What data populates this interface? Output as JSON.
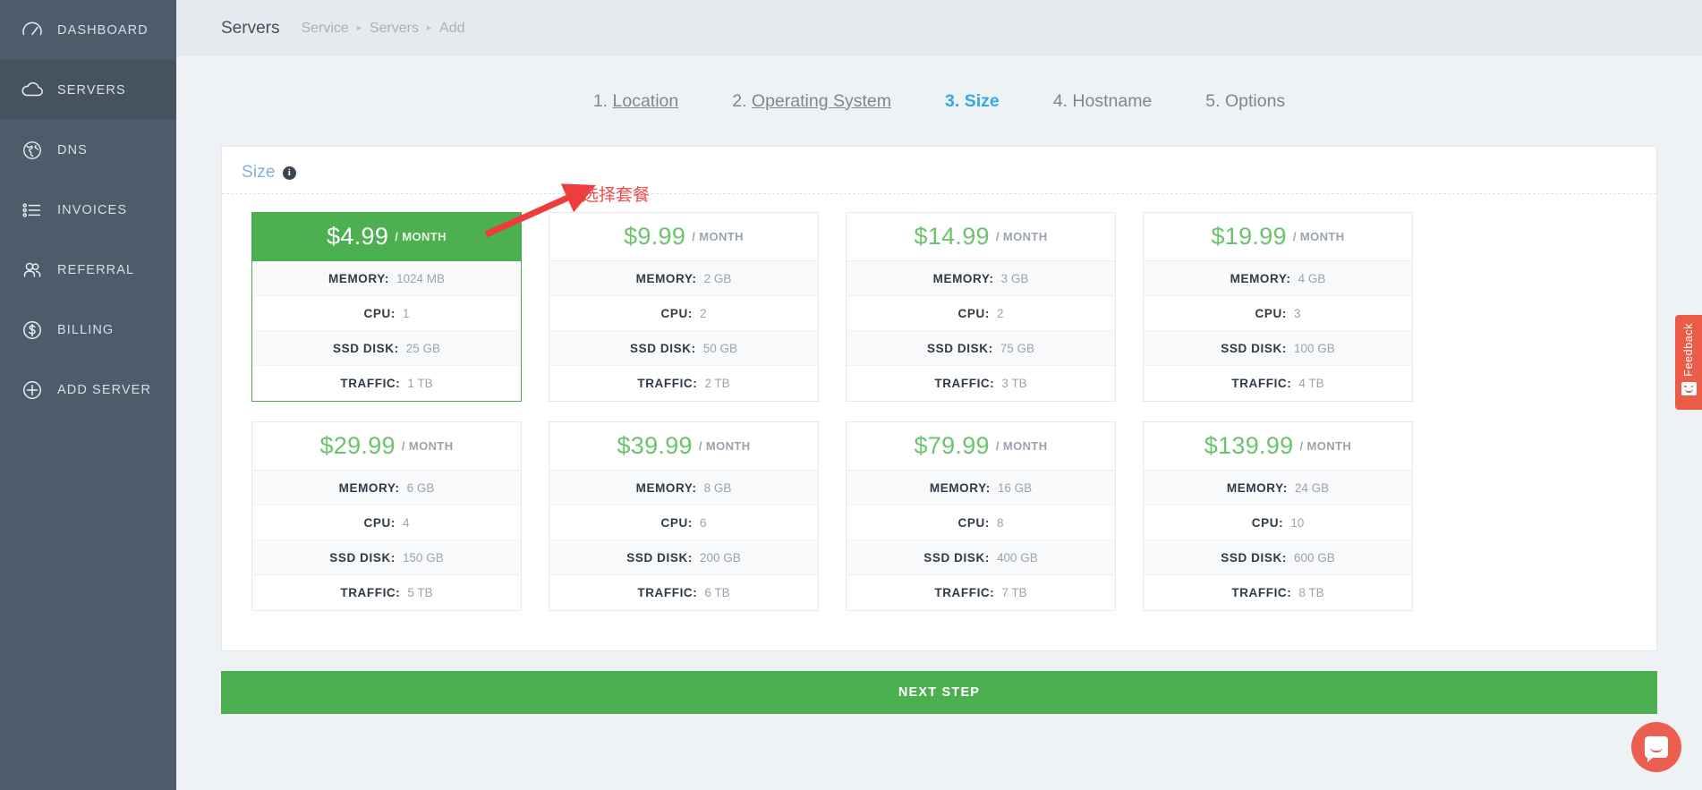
{
  "sidebar": {
    "items": [
      {
        "label": "DASHBOARD",
        "icon": "gauge-icon",
        "active": false
      },
      {
        "label": "SERVERS",
        "icon": "cloud-icon",
        "active": true
      },
      {
        "label": "DNS",
        "icon": "globe-icon",
        "active": false
      },
      {
        "label": "INVOICES",
        "icon": "list-icon",
        "active": false
      },
      {
        "label": "REFERRAL",
        "icon": "users-icon",
        "active": false
      },
      {
        "label": "BILLING",
        "icon": "dollar-circle-icon",
        "active": false
      },
      {
        "label": "ADD SERVER",
        "icon": "plus-circle-icon",
        "active": false
      }
    ]
  },
  "header": {
    "title": "Servers",
    "breadcrumb": [
      "Service",
      "Servers",
      "Add"
    ],
    "separator": "▸"
  },
  "wizard": {
    "steps": [
      {
        "num": "1.",
        "label": "Location",
        "state": "done"
      },
      {
        "num": "2.",
        "label": "Operating System",
        "state": "done"
      },
      {
        "num": "3.",
        "label": "Size",
        "state": "active"
      },
      {
        "num": "4.",
        "label": "Hostname",
        "state": "future"
      },
      {
        "num": "5.",
        "label": "Options",
        "state": "future"
      }
    ]
  },
  "panel": {
    "title": "Size",
    "info_icon": "i"
  },
  "spec_labels": {
    "memory": "MEMORY:",
    "cpu": "CPU:",
    "ssd": "SSD DISK:",
    "traffic": "TRAFFIC:"
  },
  "per_month": "/ MONTH",
  "plans": [
    {
      "price": "$4.99",
      "memory": "1024 MB",
      "cpu": "1",
      "ssd": "25 GB",
      "traffic": "1 TB",
      "selected": true
    },
    {
      "price": "$9.99",
      "memory": "2 GB",
      "cpu": "2",
      "ssd": "50 GB",
      "traffic": "2 TB",
      "selected": false
    },
    {
      "price": "$14.99",
      "memory": "3 GB",
      "cpu": "2",
      "ssd": "75 GB",
      "traffic": "3 TB",
      "selected": false
    },
    {
      "price": "$19.99",
      "memory": "4 GB",
      "cpu": "3",
      "ssd": "100 GB",
      "traffic": "4 TB",
      "selected": false
    },
    {
      "price": "$29.99",
      "memory": "6 GB",
      "cpu": "4",
      "ssd": "150 GB",
      "traffic": "5 TB",
      "selected": false
    },
    {
      "price": "$39.99",
      "memory": "8 GB",
      "cpu": "6",
      "ssd": "200 GB",
      "traffic": "6 TB",
      "selected": false
    },
    {
      "price": "$79.99",
      "memory": "16 GB",
      "cpu": "8",
      "ssd": "400 GB",
      "traffic": "7 TB",
      "selected": false
    },
    {
      "price": "$139.99",
      "memory": "24 GB",
      "cpu": "10",
      "ssd": "600 GB",
      "traffic": "8 TB",
      "selected": false
    }
  ],
  "next_button": {
    "label": "NEXT STEP"
  },
  "annotation": {
    "text": "选择套餐",
    "color": "#ee3b3b"
  },
  "feedback": {
    "label": "Feedback"
  },
  "colors": {
    "sidebar_bg": "#4d5b6a",
    "sidebar_active": "#46535f",
    "page_bg": "#eef2f5",
    "accent_green": "#4caf50",
    "price_green": "#6cc36e",
    "active_step_blue": "#35a8e0",
    "panel_title_blue": "#83b2d9",
    "feedback_orange": "#ea5b48",
    "chat_orange": "#ec5e4f",
    "annotation_red": "#ee3b3b"
  }
}
